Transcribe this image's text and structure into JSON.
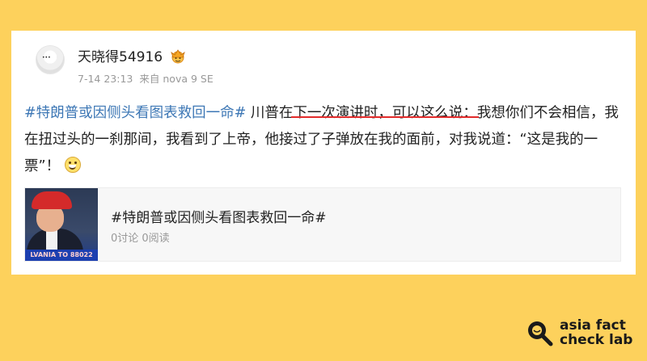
{
  "post": {
    "username": "天晓得54916",
    "timestamp": "7-14 23:13",
    "source_prefix": "来自",
    "device": "nova 9 SE",
    "hashtag": "#特朗普或因侧头看图表救回一命#",
    "text_before_underline": " 川普在",
    "underlined_text": "下一次演讲时，可以这么说：",
    "text_after_underline": "我想你们不会相信，我在扭过头的一刹那间，我看到了上帝，他接过了子弹放在我的面前，对我说道：“这是我的一票”！"
  },
  "topic_card": {
    "title": "#特朗普或因侧头看图表救回一命#",
    "stats": "0讨论 0阅读",
    "thumbnail_banner": "LVANIA TO 88022"
  },
  "brand": {
    "line1": "asia fact",
    "line2": "check lab"
  },
  "icons": {
    "avatar": "avatar",
    "vip_badge": "vip-crown-icon",
    "emoji": "grin-emoji-icon",
    "brand": "magnifier-logo-icon"
  },
  "colors": {
    "background": "#fdd15c",
    "hashtag": "#3d77b5",
    "underline": "#e22b2b"
  }
}
